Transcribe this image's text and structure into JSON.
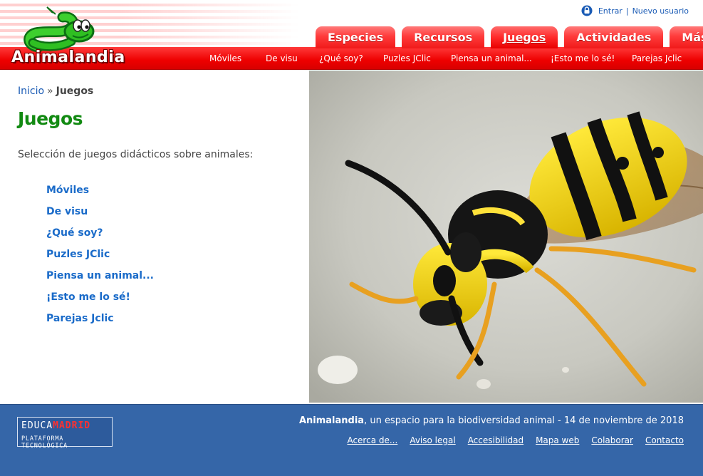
{
  "header": {
    "logo_text": "Animalandia",
    "user_links": {
      "login": "Entrar",
      "separator": "|",
      "register": "Nuevo usuario"
    },
    "tabs": [
      {
        "label": "Especies",
        "active": false
      },
      {
        "label": "Recursos",
        "active": false
      },
      {
        "label": "Juegos",
        "active": true
      },
      {
        "label": "Actividades",
        "active": false
      },
      {
        "label": "Más...",
        "active": false
      }
    ],
    "subnav": [
      "Móviles",
      "De visu",
      "¿Qué soy?",
      "Puzles JClic",
      "Piensa un animal...",
      "¡Esto me lo sé!",
      "Parejas Jclic"
    ]
  },
  "breadcrumb": {
    "home": "Inicio",
    "separator": "»",
    "current": "Juegos"
  },
  "main": {
    "title": "Juegos",
    "intro": "Selección de juegos didácticos sobre animales:",
    "games": [
      "Móviles",
      "De visu",
      "¿Qué soy?",
      "Puzles JClic",
      "Piensa un animal...",
      "¡Esto me lo sé!",
      "Parejas Jclic"
    ]
  },
  "footer": {
    "badge": {
      "top_left": "EDUCA",
      "top_right": "MADRID",
      "bottom": "PLATAFORMA TECNOLÓGICA"
    },
    "site_name": "Animalandia",
    "tagline": ", un espacio para la biodiversidad animal - 14 de noviembre de 2018",
    "links": [
      "Acerca de...",
      "Aviso legal",
      "Accesibilidad",
      "Mapa web",
      "Colaborar",
      "Contacto"
    ]
  },
  "colors": {
    "brand_red": "#ee0000",
    "title_green": "#128a12",
    "link_blue": "#1a6bc9",
    "footer_blue": "#3566a8"
  }
}
